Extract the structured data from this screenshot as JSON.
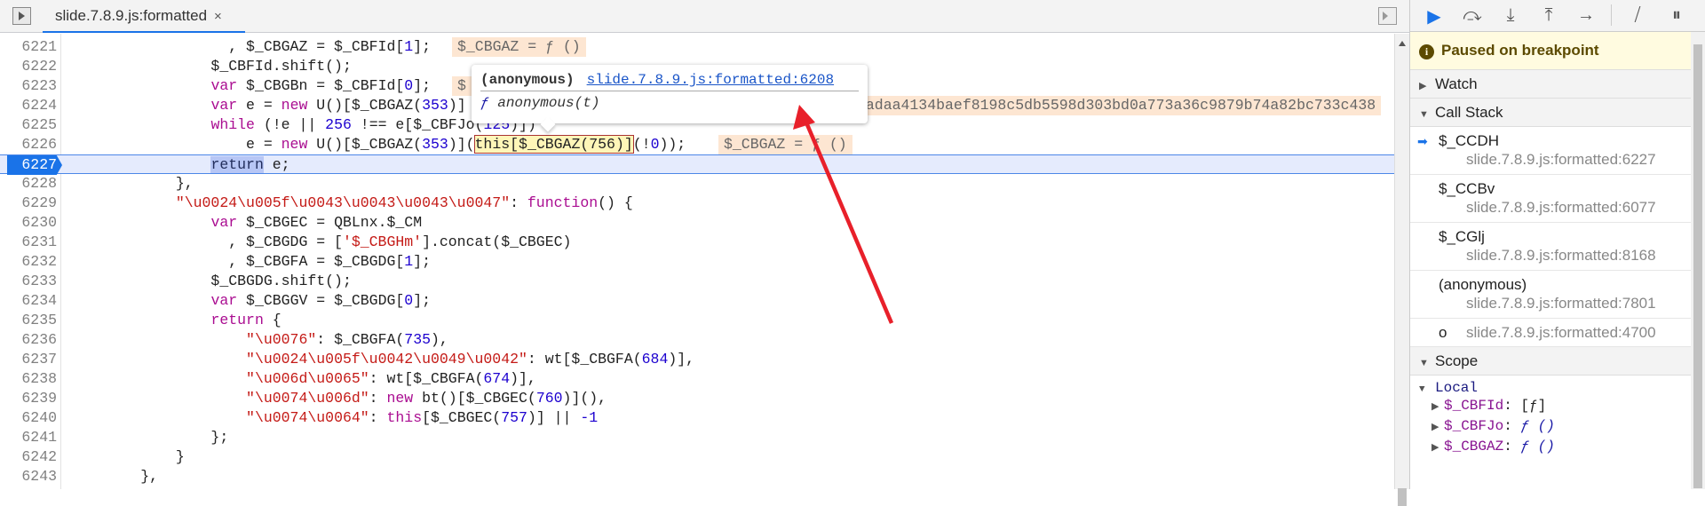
{
  "tab": {
    "title": "slide.7.8.9.js:formatted",
    "close": "×"
  },
  "editor": {
    "current_line": "6227",
    "lines": [
      {
        "num": "6221",
        "tokens": [
          [
            "p",
            "                  , $_CBGAZ = $_CBFId["
          ],
          [
            "n",
            "1"
          ],
          [
            "p",
            "];"
          ]
        ],
        "annotation": {
          "text": "$_CBGAZ = ƒ ()",
          "col": 43
        }
      },
      {
        "num": "6222",
        "tokens": [
          [
            "p",
            "                $_CBFId.shift();"
          ]
        ]
      },
      {
        "num": "6223",
        "tokens": [
          [
            "p",
            "                "
          ],
          [
            "k",
            "var"
          ],
          [
            "p",
            " $_CBGBn = $_CBFId["
          ],
          [
            "n",
            "0"
          ],
          [
            "p",
            "];"
          ]
        ],
        "annotation": {
          "text": "$",
          "col": 43
        }
      },
      {
        "num": "6224",
        "tokens": [
          [
            "p",
            "                "
          ],
          [
            "k",
            "var"
          ],
          [
            "p",
            " e = "
          ],
          [
            "k",
            "new"
          ],
          [
            "p",
            " U()[$_CBGAZ("
          ],
          [
            "n",
            "353"
          ],
          [
            "p",
            ")]"
          ]
        ],
        "annotation": {
          "text": "3adaa4134baef8198c5db5598d303bd0a773a36c9879b74a82bc733c438",
          "col": 88
        }
      },
      {
        "num": "6225",
        "tokens": [
          [
            "p",
            "                "
          ],
          [
            "k",
            "while"
          ],
          [
            "p",
            " (!e || "
          ],
          [
            "n",
            "256"
          ],
          [
            "p",
            " !== e[$_CBFJo("
          ],
          [
            "n",
            "125"
          ],
          [
            "p",
            ")])"
          ]
        ]
      },
      {
        "num": "6226",
        "tokens": [
          [
            "p",
            "                    e = "
          ],
          [
            "k",
            "new"
          ],
          [
            "p",
            " U()[$_CBGAZ("
          ],
          [
            "n",
            "353"
          ],
          [
            "p",
            ")]("
          ],
          [
            "h",
            "this[$_CBGAZ(756)]"
          ],
          [
            "p",
            "(!"
          ],
          [
            "n",
            "0"
          ],
          [
            "p",
            "));"
          ]
        ],
        "annotation": {
          "text": "$_CBGAZ = ƒ ()",
          "col": 73
        }
      },
      {
        "num": "6227",
        "tokens": [
          [
            "p",
            "                "
          ],
          [
            "sel",
            "return"
          ],
          [
            "p",
            " e;"
          ]
        ]
      },
      {
        "num": "6228",
        "tokens": [
          [
            "p",
            "            },"
          ]
        ]
      },
      {
        "num": "6229",
        "tokens": [
          [
            "p",
            "            "
          ],
          [
            "s",
            "\"\\u0024\\u005f\\u0043\\u0043\\u0043\\u0047\""
          ],
          [
            "p",
            ": "
          ],
          [
            "k",
            "function"
          ],
          [
            "p",
            "() {"
          ]
        ]
      },
      {
        "num": "6230",
        "tokens": [
          [
            "p",
            "                "
          ],
          [
            "k",
            "var"
          ],
          [
            "p",
            " $_CBGEC = QBLnx.$_CM"
          ]
        ]
      },
      {
        "num": "6231",
        "tokens": [
          [
            "p",
            "                  , $_CBGDG = ["
          ],
          [
            "s",
            "'$_CBGHm'"
          ],
          [
            "p",
            "].concat($_CBGEC)"
          ]
        ]
      },
      {
        "num": "6232",
        "tokens": [
          [
            "p",
            "                  , $_CBGFA = $_CBGDG["
          ],
          [
            "n",
            "1"
          ],
          [
            "p",
            "];"
          ]
        ]
      },
      {
        "num": "6233",
        "tokens": [
          [
            "p",
            "                $_CBGDG.shift();"
          ]
        ]
      },
      {
        "num": "6234",
        "tokens": [
          [
            "p",
            "                "
          ],
          [
            "k",
            "var"
          ],
          [
            "p",
            " $_CBGGV = $_CBGDG["
          ],
          [
            "n",
            "0"
          ],
          [
            "p",
            "];"
          ]
        ]
      },
      {
        "num": "6235",
        "tokens": [
          [
            "p",
            "                "
          ],
          [
            "k",
            "return"
          ],
          [
            "p",
            " {"
          ]
        ]
      },
      {
        "num": "6236",
        "tokens": [
          [
            "p",
            "                    "
          ],
          [
            "s",
            "\"\\u0076\""
          ],
          [
            "p",
            ": $_CBGFA("
          ],
          [
            "n",
            "735"
          ],
          [
            "p",
            "),"
          ]
        ]
      },
      {
        "num": "6237",
        "tokens": [
          [
            "p",
            "                    "
          ],
          [
            "s",
            "\"\\u0024\\u005f\\u0042\\u0049\\u0042\""
          ],
          [
            "p",
            ": wt[$_CBGFA("
          ],
          [
            "n",
            "684"
          ],
          [
            "p",
            ")],"
          ]
        ]
      },
      {
        "num": "6238",
        "tokens": [
          [
            "p",
            "                    "
          ],
          [
            "s",
            "\"\\u006d\\u0065\""
          ],
          [
            "p",
            ": wt[$_CBGFA("
          ],
          [
            "n",
            "674"
          ],
          [
            "p",
            ")],"
          ]
        ]
      },
      {
        "num": "6239",
        "tokens": [
          [
            "p",
            "                    "
          ],
          [
            "s",
            "\"\\u0074\\u006d\""
          ],
          [
            "p",
            ": "
          ],
          [
            "k",
            "new"
          ],
          [
            "p",
            " bt()[$_CBGEC("
          ],
          [
            "n",
            "760"
          ],
          [
            "p",
            ")](),"
          ]
        ]
      },
      {
        "num": "6240",
        "tokens": [
          [
            "p",
            "                    "
          ],
          [
            "s",
            "\"\\u0074\\u0064\""
          ],
          [
            "p",
            ": "
          ],
          [
            "k",
            "this"
          ],
          [
            "p",
            "[$_CBGEC("
          ],
          [
            "n",
            "757"
          ],
          [
            "p",
            ")] || "
          ],
          [
            "n",
            "-1"
          ]
        ]
      },
      {
        "num": "6241",
        "tokens": [
          [
            "p",
            "                };"
          ]
        ]
      },
      {
        "num": "6242",
        "tokens": [
          [
            "p",
            "            }"
          ]
        ]
      },
      {
        "num": "6243",
        "tokens": [
          [
            "p",
            "        },"
          ]
        ]
      }
    ]
  },
  "tooltip": {
    "title": "(anonymous)",
    "link": "slide.7.8.9.js:formatted:6208",
    "signature_f": "ƒ",
    "signature": "anonymous(t)"
  },
  "annotation_arrow": {
    "color": "#e8202a"
  },
  "debugger": {
    "toolbar": {
      "resume": "resume-icon",
      "step_over": "step-over-icon",
      "step_into": "step-into-icon",
      "step_out": "step-out-icon",
      "step": "step-icon",
      "deactivate": "deactivate-breakpoints-icon",
      "pause": "pause-on-exceptions-icon"
    },
    "paused_message": "Paused on breakpoint",
    "watch_label": "Watch",
    "call_stack_label": "Call Stack",
    "call_stack": [
      {
        "name": "$_CCDH",
        "location": "slide.7.8.9.js:formatted:6227",
        "current": true
      },
      {
        "name": "$_CCBv",
        "location": "slide.7.8.9.js:formatted:6077"
      },
      {
        "name": "$_CGlj",
        "location": "slide.7.8.9.js:formatted:8168"
      },
      {
        "name": "(anonymous)",
        "location": "slide.7.8.9.js:formatted:7801"
      },
      {
        "name": "o",
        "location": "slide.7.8.9.js:formatted:4700"
      }
    ],
    "scope_label": "Scope",
    "local_label": "Local",
    "scope_vars": [
      {
        "name": "$_CBFId",
        "value": "[ƒ]",
        "is_function": false
      },
      {
        "name": "$_CBFJo",
        "value": "ƒ ()",
        "is_function": true
      },
      {
        "name": "$_CBGAZ",
        "value": "ƒ ()",
        "is_function": true
      }
    ]
  }
}
